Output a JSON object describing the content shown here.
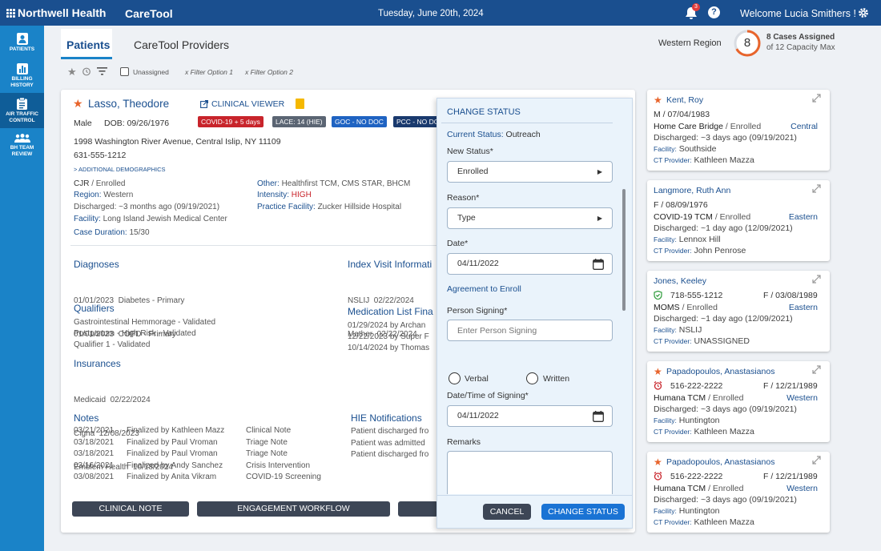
{
  "header": {
    "brand": "Northwell Health",
    "app_name": "CareTool",
    "date": "Tuesday, June 20th, 2024",
    "notif_count": "3",
    "welcome": "Welcome Lucia Smithers !"
  },
  "sidebar": {
    "items": [
      {
        "label1": "PATIENTS",
        "label2": ""
      },
      {
        "label1": "BILLING",
        "label2": "HISTORY"
      },
      {
        "label1": "AIR TRAFFIC",
        "label2": "CONTROL"
      },
      {
        "label1": "BH TEAM",
        "label2": "REVIEW"
      }
    ]
  },
  "tabs": [
    "Patients",
    "CareTool Providers"
  ],
  "region": "Western Region",
  "cases": {
    "count": "8",
    "assigned": "8 Cases Assigned",
    "capacity": "of 12 Capacity Max",
    "fraction": 0.67
  },
  "filters": {
    "unassigned": "Unassigned",
    "option1": "x Filter Option 1",
    "option2": "x Filter Option 2"
  },
  "patient": {
    "name": "Lasso, Theodore",
    "clinical_viewer": "CLINICAL VIEWER",
    "sex": "Male",
    "dob": "DOB: 09/26/1976",
    "badges": [
      "COVID-19 + 5 days",
      "LACE: 14 (HIE)",
      "GOC - NO DOC",
      "PCC - NO DOC"
    ],
    "address": "1998 Washington River Avenue, Central Islip, NY 11109",
    "phone": "631-555-1212",
    "additional": "> ADDITIONAL DEMOGRAPHICS",
    "program": "CJR",
    "program_status": " / Enrolled",
    "region_label": "Region:",
    "region_value": " Western",
    "discharged": "Discharged: ~3 months ago (09/19/2021)",
    "facility_label": "Facility:",
    "facility_value": " Long Island Jewish Medical Center",
    "duration_label": "Case Duration:",
    "duration_value": " 15/30",
    "other_label": "Other:",
    "other_value": " Healthfirst TCM, CMS STAR, BHCM",
    "intensity_label": "Intensity:",
    "intensity_value": " HIGH",
    "practice_label": "Practice Facility:",
    "practice_value": " Zucker Hillside Hospital"
  },
  "diagnoses": {
    "title": "Diagnoses",
    "items": [
      "01/01/2023  Diabetes - Primary",
      "01/01/2023  COPD - Primary"
    ]
  },
  "qualifiers": {
    "title": "Qualifiers",
    "items": [
      "Gastrointestinal Hemmorage - Validated",
      "Postpartum - High Risk - Validated",
      "Qualifier 1 - Validated"
    ]
  },
  "insurances": {
    "title": "Insurances",
    "items": [
      "Medicaid  02/22/2024",
      "Cigna  12/08/2023",
      "Emblem Health  10/18/2024"
    ]
  },
  "index_visit": {
    "title": "Index Visit Informati",
    "items": [
      "NSLIJ  02/22/2024",
      "Mather  02/22/2024"
    ]
  },
  "medication": {
    "title": "Medication List Fina",
    "items": [
      "01/29/2024 by Archan",
      "12/22/2023 by Super F",
      "10/14/2024 by Thomas"
    ]
  },
  "notes": {
    "title": "Notes",
    "rows": [
      [
        "03/21/2021",
        "Finalized by Kathleen Mazz",
        "Clinical Note"
      ],
      [
        "03/18/2021",
        "Finalized by Paul Vroman",
        "Triage Note"
      ],
      [
        "03/18/2021",
        "Finalized by Paul Vroman",
        "Triage Note"
      ],
      [
        "03/16/2021",
        "Finalized by Andy Sanchez",
        "Crisis Intervention"
      ],
      [
        "03/08/2021",
        "Finalized by Anita Vikram",
        "COVID-19 Screening"
      ]
    ]
  },
  "hie": {
    "title": "HIE Notifications",
    "items": [
      "Patient discharged fro",
      "Patient was admitted",
      "Patient discharged fro"
    ]
  },
  "actions": [
    "CLINICAL NOTE",
    "ENGAGEMENT WORKFLOW"
  ],
  "change_status": {
    "title": "CHANGE STATUS",
    "current_label": "Current Status:",
    "current_value": " Outreach",
    "new_status_label": "New Status*",
    "new_status_value": "Enrolled",
    "reason_label": "Reason*",
    "reason_value": "Type",
    "date_label": "Date*",
    "date_value": "04/11/2022",
    "agreement": "Agreement to Enroll",
    "person_label": "Person Signing*",
    "person_placeholder": "Enter Person Signing",
    "verbal": "Verbal",
    "written": "Written",
    "dt_label": "Date/Time of Signing*",
    "dt_value": "04/11/2022",
    "remarks_label": "Remarks",
    "cancel": "CANCEL",
    "submit": "CHANGE STATUS"
  },
  "side_cards": [
    {
      "name": "Kent, Roy",
      "starred": true,
      "line2": "M / 07/04/1983",
      "program": "Home Care Bridge",
      "status": " / Enrolled",
      "region": "Central",
      "discharged": "Discharged: ~3 days ago (09/19/2021)",
      "facility": "Southside",
      "provider": "Kathleen Mazza"
    },
    {
      "name": "Langmore, Ruth Ann",
      "starred": false,
      "line2": "F / 08/09/1976",
      "program": "COVID-19 TCM",
      "status": " / Enrolled",
      "region": "Eastern",
      "discharged": "Discharged: ~1 day ago (12/09/2021)",
      "facility": "Lennox Hill",
      "provider": "John Penrose"
    },
    {
      "name": "Jones, Keeley",
      "starred": false,
      "phone": "718-555-1212",
      "line2": "F / 03/08/1989",
      "program": "MOMS",
      "status": " / Enrolled",
      "region": "Eastern",
      "discharged": "Discharged: ~1 day ago (12/09/2021)",
      "facility": "NSLIJ",
      "provider": "UNASSIGNED"
    },
    {
      "name": "Papadopoulos, Anastasianos",
      "starred": true,
      "phone": "516-222-2222",
      "line2": "F / 12/21/1989",
      "program": "Humana TCM",
      "status": " / Enrolled",
      "region": "Western",
      "discharged": "Discharged: ~3 days ago (09/19/2021)",
      "facility": "Huntington",
      "provider": "Kathleen Mazza"
    },
    {
      "name": "Papadopoulos, Anastasianos",
      "starred": true,
      "phone": "516-222-2222",
      "line2": "F / 12/21/1989",
      "program": "Humana TCM",
      "status": " / Enrolled",
      "region": "Western",
      "discharged": "Discharged: ~3 days ago (09/19/2021)",
      "facility": "Huntington",
      "provider": "Kathleen Mazza"
    }
  ],
  "labels": {
    "facility": "Facility:",
    "provider": "CT Provider:"
  }
}
